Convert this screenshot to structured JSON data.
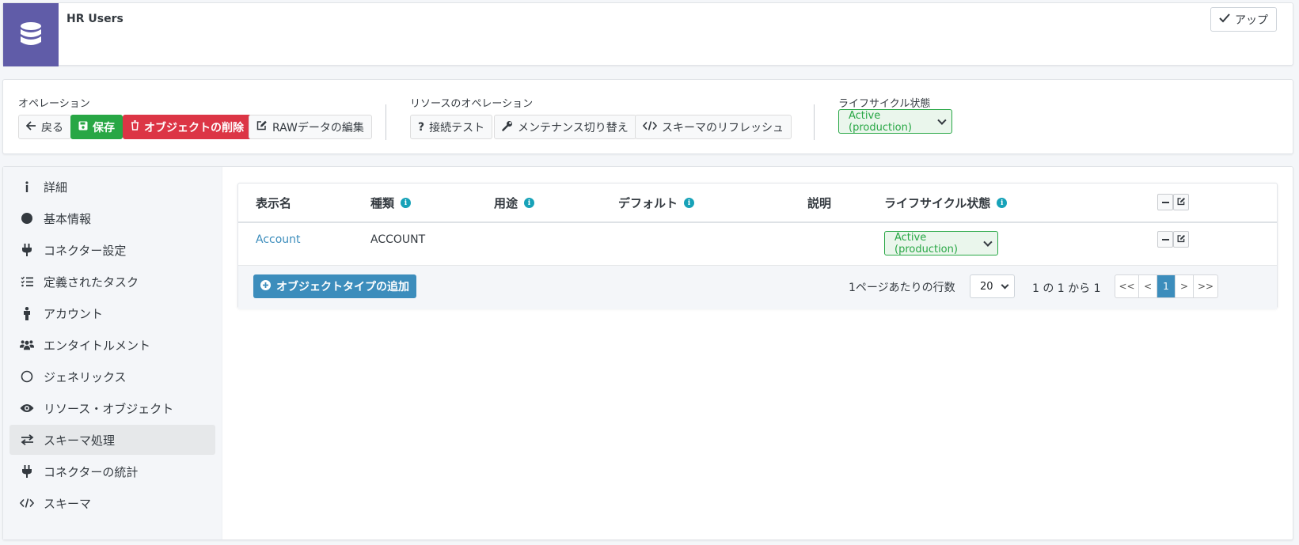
{
  "header": {
    "title": "HR Users",
    "up_label": "アップ"
  },
  "operations": {
    "label": "オペレーション",
    "back": "戻る",
    "save": "保存",
    "delete": "オブジェクトの削除",
    "edit_raw": "RAWデータの編集"
  },
  "resource_operations": {
    "label": "リソースのオペレーション",
    "test_connection": "接続テスト",
    "toggle_maintenance": "メンテナンス切り替え",
    "refresh_schema": "スキーマのリフレッシュ"
  },
  "lifecycle": {
    "label": "ライフサイクル状態",
    "value": "Active (production)"
  },
  "sidebar": {
    "items": [
      {
        "label": "詳細",
        "icon": "info-icon"
      },
      {
        "label": "基本情報",
        "icon": "circle-icon"
      },
      {
        "label": "コネクター設定",
        "icon": "plug-icon"
      },
      {
        "label": "定義されたタスク",
        "icon": "tasks-icon"
      },
      {
        "label": "アカウント",
        "icon": "person-icon"
      },
      {
        "label": "エンタイトルメント",
        "icon": "users-icon"
      },
      {
        "label": "ジェネリックス",
        "icon": "circle-outline-icon"
      },
      {
        "label": "リソース・オブジェクト",
        "icon": "eye-icon"
      },
      {
        "label": "スキーマ処理",
        "icon": "exchange-icon",
        "active": true
      },
      {
        "label": "コネクターの統計",
        "icon": "plug-icon"
      },
      {
        "label": "スキーマ",
        "icon": "code-icon"
      }
    ]
  },
  "table": {
    "columns": [
      "表示名",
      "種類",
      "用途",
      "デフォルト",
      "説明",
      "ライフサイクル状態"
    ],
    "rows": [
      {
        "name": "Account",
        "kind": "ACCOUNT",
        "purpose": "",
        "default": "",
        "description": "",
        "lifecycle": "Active (production)"
      }
    ],
    "add_button": "オブジェクトタイプの追加",
    "rows_per_page_label": "1ページあたりの行数",
    "rows_per_page": "20",
    "range_text": "1 の 1 から 1",
    "pager": [
      "<<",
      "<",
      "1",
      ">",
      ">>"
    ]
  },
  "colors": {
    "brand": "#605ca8",
    "success": "#28a745",
    "danger": "#dc3545",
    "info": "#3c8dbc",
    "link": "#3c8dbc"
  }
}
